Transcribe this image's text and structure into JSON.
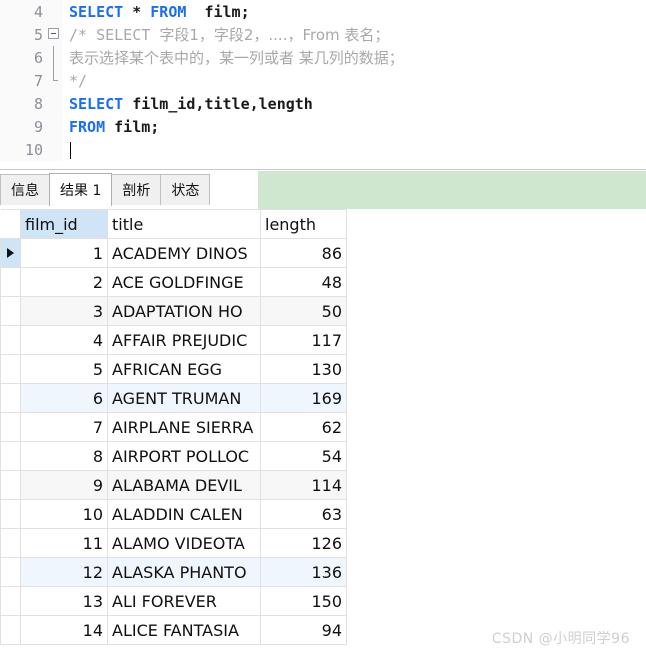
{
  "editor": {
    "lines": [
      {
        "number": "4",
        "fold": "none",
        "segments": [
          {
            "text": "SELECT ",
            "style": "kw"
          },
          {
            "text": "* ",
            "style": "plain"
          },
          {
            "text": "FROM ",
            "style": "kw"
          },
          {
            "text": " film;",
            "style": "plain"
          }
        ]
      },
      {
        "number": "5",
        "fold": "start",
        "segments": [
          {
            "text": "/* SELECT ",
            "style": "cmt-mono"
          },
          {
            "text": "字段1，字段2，....，From 表名；",
            "style": "cmt"
          }
        ]
      },
      {
        "number": "6",
        "fold": "mid",
        "segments": [
          {
            "text": "表示选择某个表中的，某一列或者 某几列的数据；",
            "style": "cmt"
          }
        ]
      },
      {
        "number": "7",
        "fold": "end",
        "segments": [
          {
            "text": "*/",
            "style": "cmt-mono"
          }
        ]
      },
      {
        "number": "8",
        "fold": "none",
        "segments": [
          {
            "text": "SELECT ",
            "style": "kw"
          },
          {
            "text": "film_id,title,length",
            "style": "plain"
          }
        ]
      },
      {
        "number": "9",
        "fold": "none",
        "segments": [
          {
            "text": "FROM ",
            "style": "kw"
          },
          {
            "text": "film;",
            "style": "plain"
          }
        ]
      },
      {
        "number": "10",
        "fold": "none",
        "caret": true,
        "segments": []
      }
    ]
  },
  "tabs": [
    {
      "label": "信息",
      "active": false
    },
    {
      "label": "结果 1",
      "active": true
    },
    {
      "label": "剖析",
      "active": false
    },
    {
      "label": "状态",
      "active": false
    }
  ],
  "result_grid": {
    "columns": [
      "film_id",
      "title",
      "length"
    ],
    "selected_column": "film_id",
    "current_row_index": 0,
    "rows": [
      {
        "film_id": "1",
        "title": "ACADEMY DINOS",
        "length": "86",
        "shade": "none"
      },
      {
        "film_id": "2",
        "title": "ACE GOLDFINGE",
        "length": "48",
        "shade": "none"
      },
      {
        "film_id": "3",
        "title": "ADAPTATION HO",
        "length": "50",
        "shade": "gray"
      },
      {
        "film_id": "4",
        "title": "AFFAIR PREJUDIC",
        "length": "117",
        "shade": "none"
      },
      {
        "film_id": "5",
        "title": "AFRICAN EGG",
        "length": "130",
        "shade": "none"
      },
      {
        "film_id": "6",
        "title": "AGENT TRUMAN",
        "length": "169",
        "shade": "blue"
      },
      {
        "film_id": "7",
        "title": "AIRPLANE SIERRA",
        "length": "62",
        "shade": "none"
      },
      {
        "film_id": "8",
        "title": "AIRPORT POLLOC",
        "length": "54",
        "shade": "none"
      },
      {
        "film_id": "9",
        "title": "ALABAMA DEVIL",
        "length": "114",
        "shade": "gray"
      },
      {
        "film_id": "10",
        "title": "ALADDIN CALEN",
        "length": "63",
        "shade": "none"
      },
      {
        "film_id": "11",
        "title": "ALAMO VIDEOTA",
        "length": "126",
        "shade": "none"
      },
      {
        "film_id": "12",
        "title": "ALASKA PHANTO",
        "length": "136",
        "shade": "blue"
      },
      {
        "film_id": "13",
        "title": "ALI FOREVER",
        "length": "150",
        "shade": "none"
      },
      {
        "film_id": "14",
        "title": "ALICE FANTASIA",
        "length": "94",
        "shade": "none"
      }
    ]
  },
  "watermark": {
    "text": "CSDN @小明同学96"
  },
  "colors": {
    "keyword": "#1a6ef5",
    "comment": "#a8a8a8",
    "tabstrip_green": "#cfe6cf",
    "header_selected": "#cfe4f7",
    "row_blue": "#f0f6fd",
    "row_gray": "#f7f7f7"
  }
}
